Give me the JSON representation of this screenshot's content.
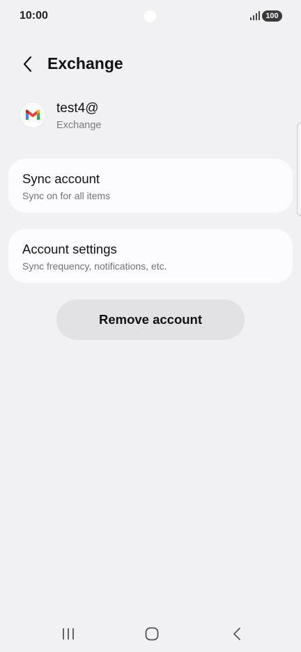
{
  "status_bar": {
    "time": "10:00",
    "battery": "100",
    "icons": [
      "camera-cutout",
      "signal-icon",
      "battery-icon"
    ]
  },
  "header": {
    "title": "Exchange",
    "back_icon": "chevron-left-icon"
  },
  "account": {
    "email": "test4@",
    "type": "Exchange",
    "icon": "gmail-logo-icon"
  },
  "cards": [
    {
      "title": "Sync account",
      "subtitle": "Sync on for all items"
    },
    {
      "title": "Account settings",
      "subtitle": "Sync frequency, notifications, etc."
    }
  ],
  "remove_button": {
    "label": "Remove account"
  },
  "nav_bar": {
    "icons": [
      "recent-apps-icon",
      "home-icon",
      "back-icon"
    ]
  },
  "colors": {
    "background": "#f1f1f3",
    "card": "#fcfcfe",
    "button": "#e2e2e4",
    "gmail_red": "#ea4335",
    "gmail_blue": "#4285f4",
    "gmail_green": "#34a853",
    "gmail_yellow": "#fbbc04"
  }
}
